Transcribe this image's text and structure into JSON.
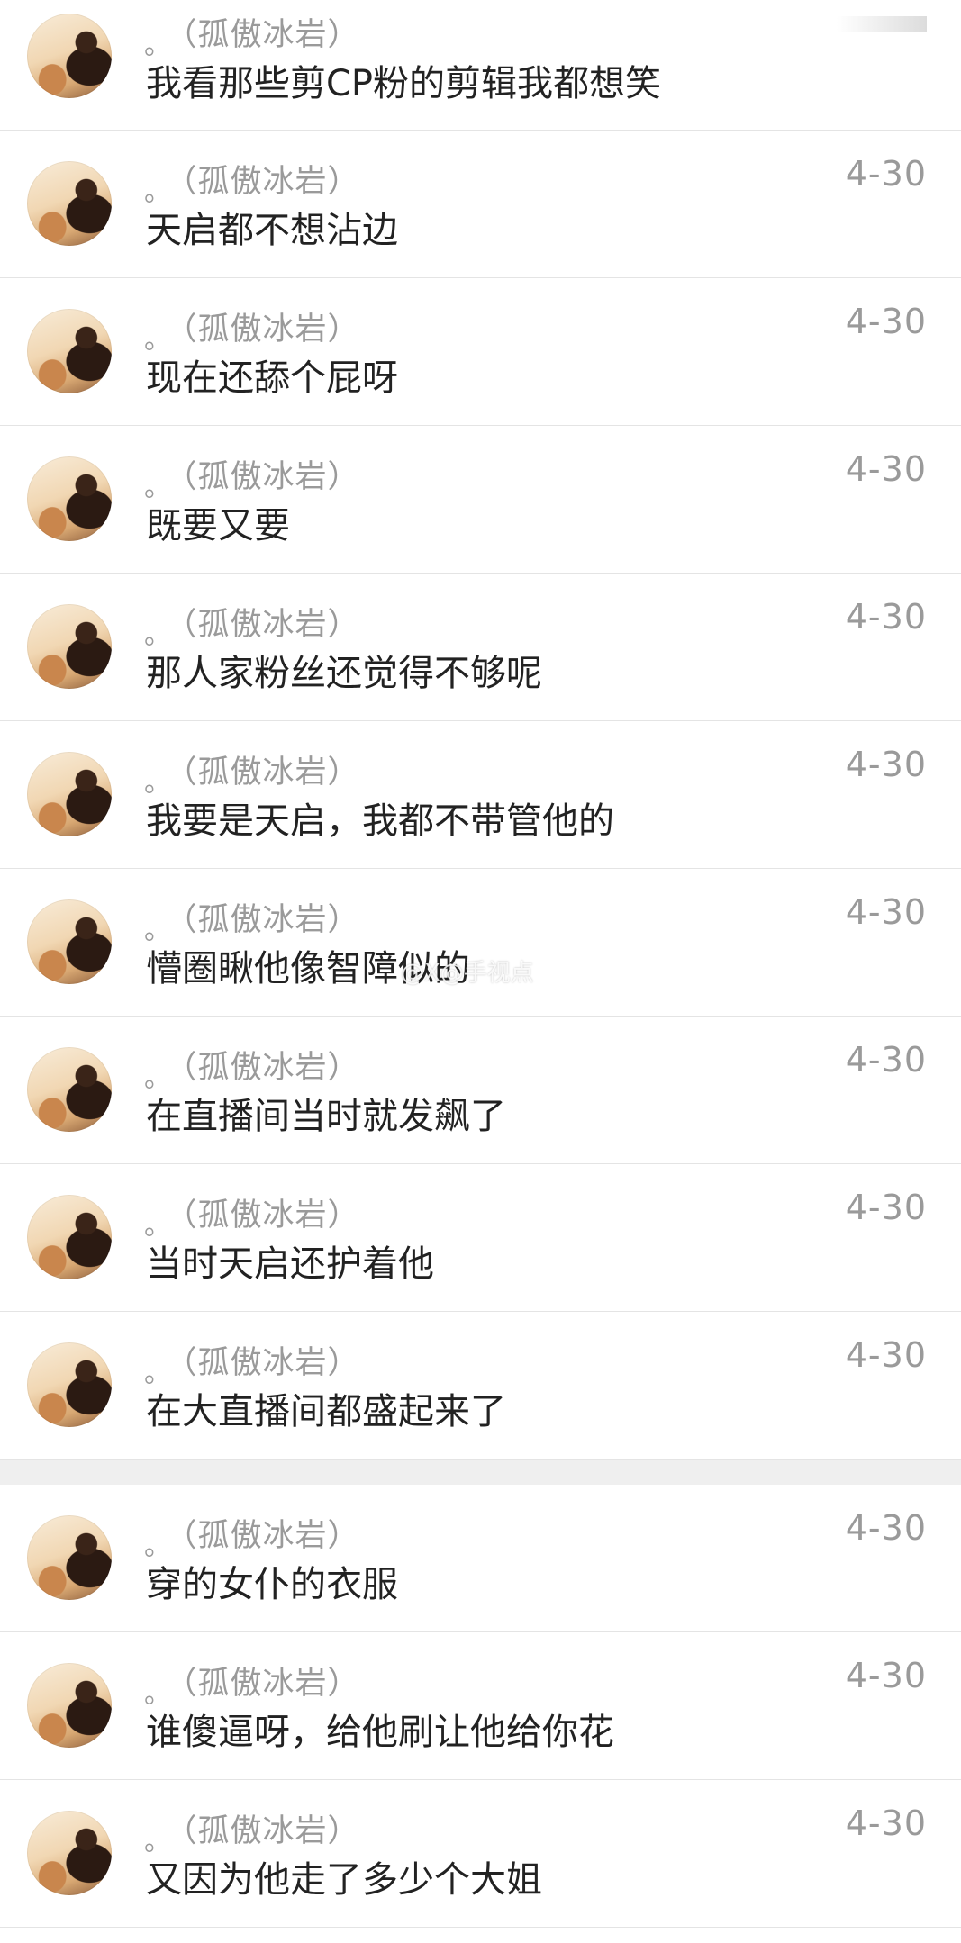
{
  "comments": [
    {
      "user": "（孤傲冰岩）",
      "date": "",
      "text": "我看那些剪CP粉的剪辑我都想笑"
    },
    {
      "user": "（孤傲冰岩）",
      "date": "4-30",
      "text": "天启都不想沾边"
    },
    {
      "user": "（孤傲冰岩）",
      "date": "4-30",
      "text": "现在还舔个屁呀"
    },
    {
      "user": "（孤傲冰岩）",
      "date": "4-30",
      "text": "既要又要"
    },
    {
      "user": "（孤傲冰岩）",
      "date": "4-30",
      "text": "那人家粉丝还觉得不够呢"
    },
    {
      "user": "（孤傲冰岩）",
      "date": "4-30",
      "text": "我要是天启，我都不带管他的"
    },
    {
      "user": "（孤傲冰岩）",
      "date": "4-30",
      "text": "懵圈瞅他像智障似的"
    },
    {
      "user": "（孤傲冰岩）",
      "date": "4-30",
      "text": "在直播间当时就发飙了"
    },
    {
      "user": "（孤傲冰岩）",
      "date": "4-30",
      "text": "当时天启还护着他"
    },
    {
      "user": "（孤傲冰岩）",
      "date": "4-30",
      "text": "在大直播间都盛起来了"
    },
    {
      "user": "（孤傲冰岩）",
      "date": "4-30",
      "text": "穿的女仆的衣服"
    },
    {
      "user": "（孤傲冰岩）",
      "date": "4-30",
      "text": "谁傻逼呀，给他刷让他给你花"
    },
    {
      "user": "（孤傲冰岩）",
      "date": "4-30",
      "text": "又因为他走了多少个大姐"
    }
  ],
  "name_prefix": "。",
  "watermark": "@X@手视点"
}
